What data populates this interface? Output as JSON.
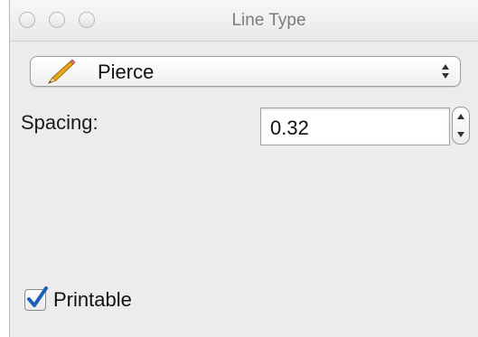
{
  "window": {
    "title": "Line Type"
  },
  "line_type_popup": {
    "selected": "Pierce",
    "icon": "pencil-icon"
  },
  "spacing": {
    "label": "Spacing:",
    "value": "0.32"
  },
  "printable": {
    "label": "Printable",
    "checked": true
  },
  "colors": {
    "window_bg": "#ececec",
    "checkmark": "#1d5fb5",
    "pencil_body": "#e5a81f"
  }
}
